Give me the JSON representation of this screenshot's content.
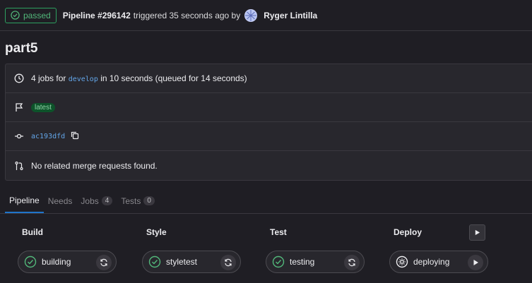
{
  "header": {
    "status": "passed",
    "pipeline_id": "Pipeline #296142",
    "triggered_text": "triggered 35 seconds ago by",
    "user": "Ryger Lintilla"
  },
  "title": "part5",
  "info": {
    "jobs_prefix": "4 jobs for",
    "branch": "develop",
    "jobs_suffix": "in 10 seconds (queued for 14 seconds)",
    "tag": "latest",
    "commit": "ac193dfd",
    "merge_requests": "No related merge requests found."
  },
  "tabs": [
    {
      "label": "Pipeline",
      "count": null
    },
    {
      "label": "Needs",
      "count": null
    },
    {
      "label": "Jobs",
      "count": "4"
    },
    {
      "label": "Tests",
      "count": "0"
    }
  ],
  "stages": [
    {
      "name": "Build",
      "job": "building",
      "status": "success",
      "action": "retry"
    },
    {
      "name": "Style",
      "job": "styletest",
      "status": "success",
      "action": "retry"
    },
    {
      "name": "Test",
      "job": "testing",
      "status": "success",
      "action": "retry"
    },
    {
      "name": "Deploy",
      "job": "deploying",
      "status": "manual",
      "action": "play"
    }
  ],
  "colors": {
    "success": "#52b87a",
    "link": "#63a6e9",
    "tab_active": "#1f75cb"
  }
}
